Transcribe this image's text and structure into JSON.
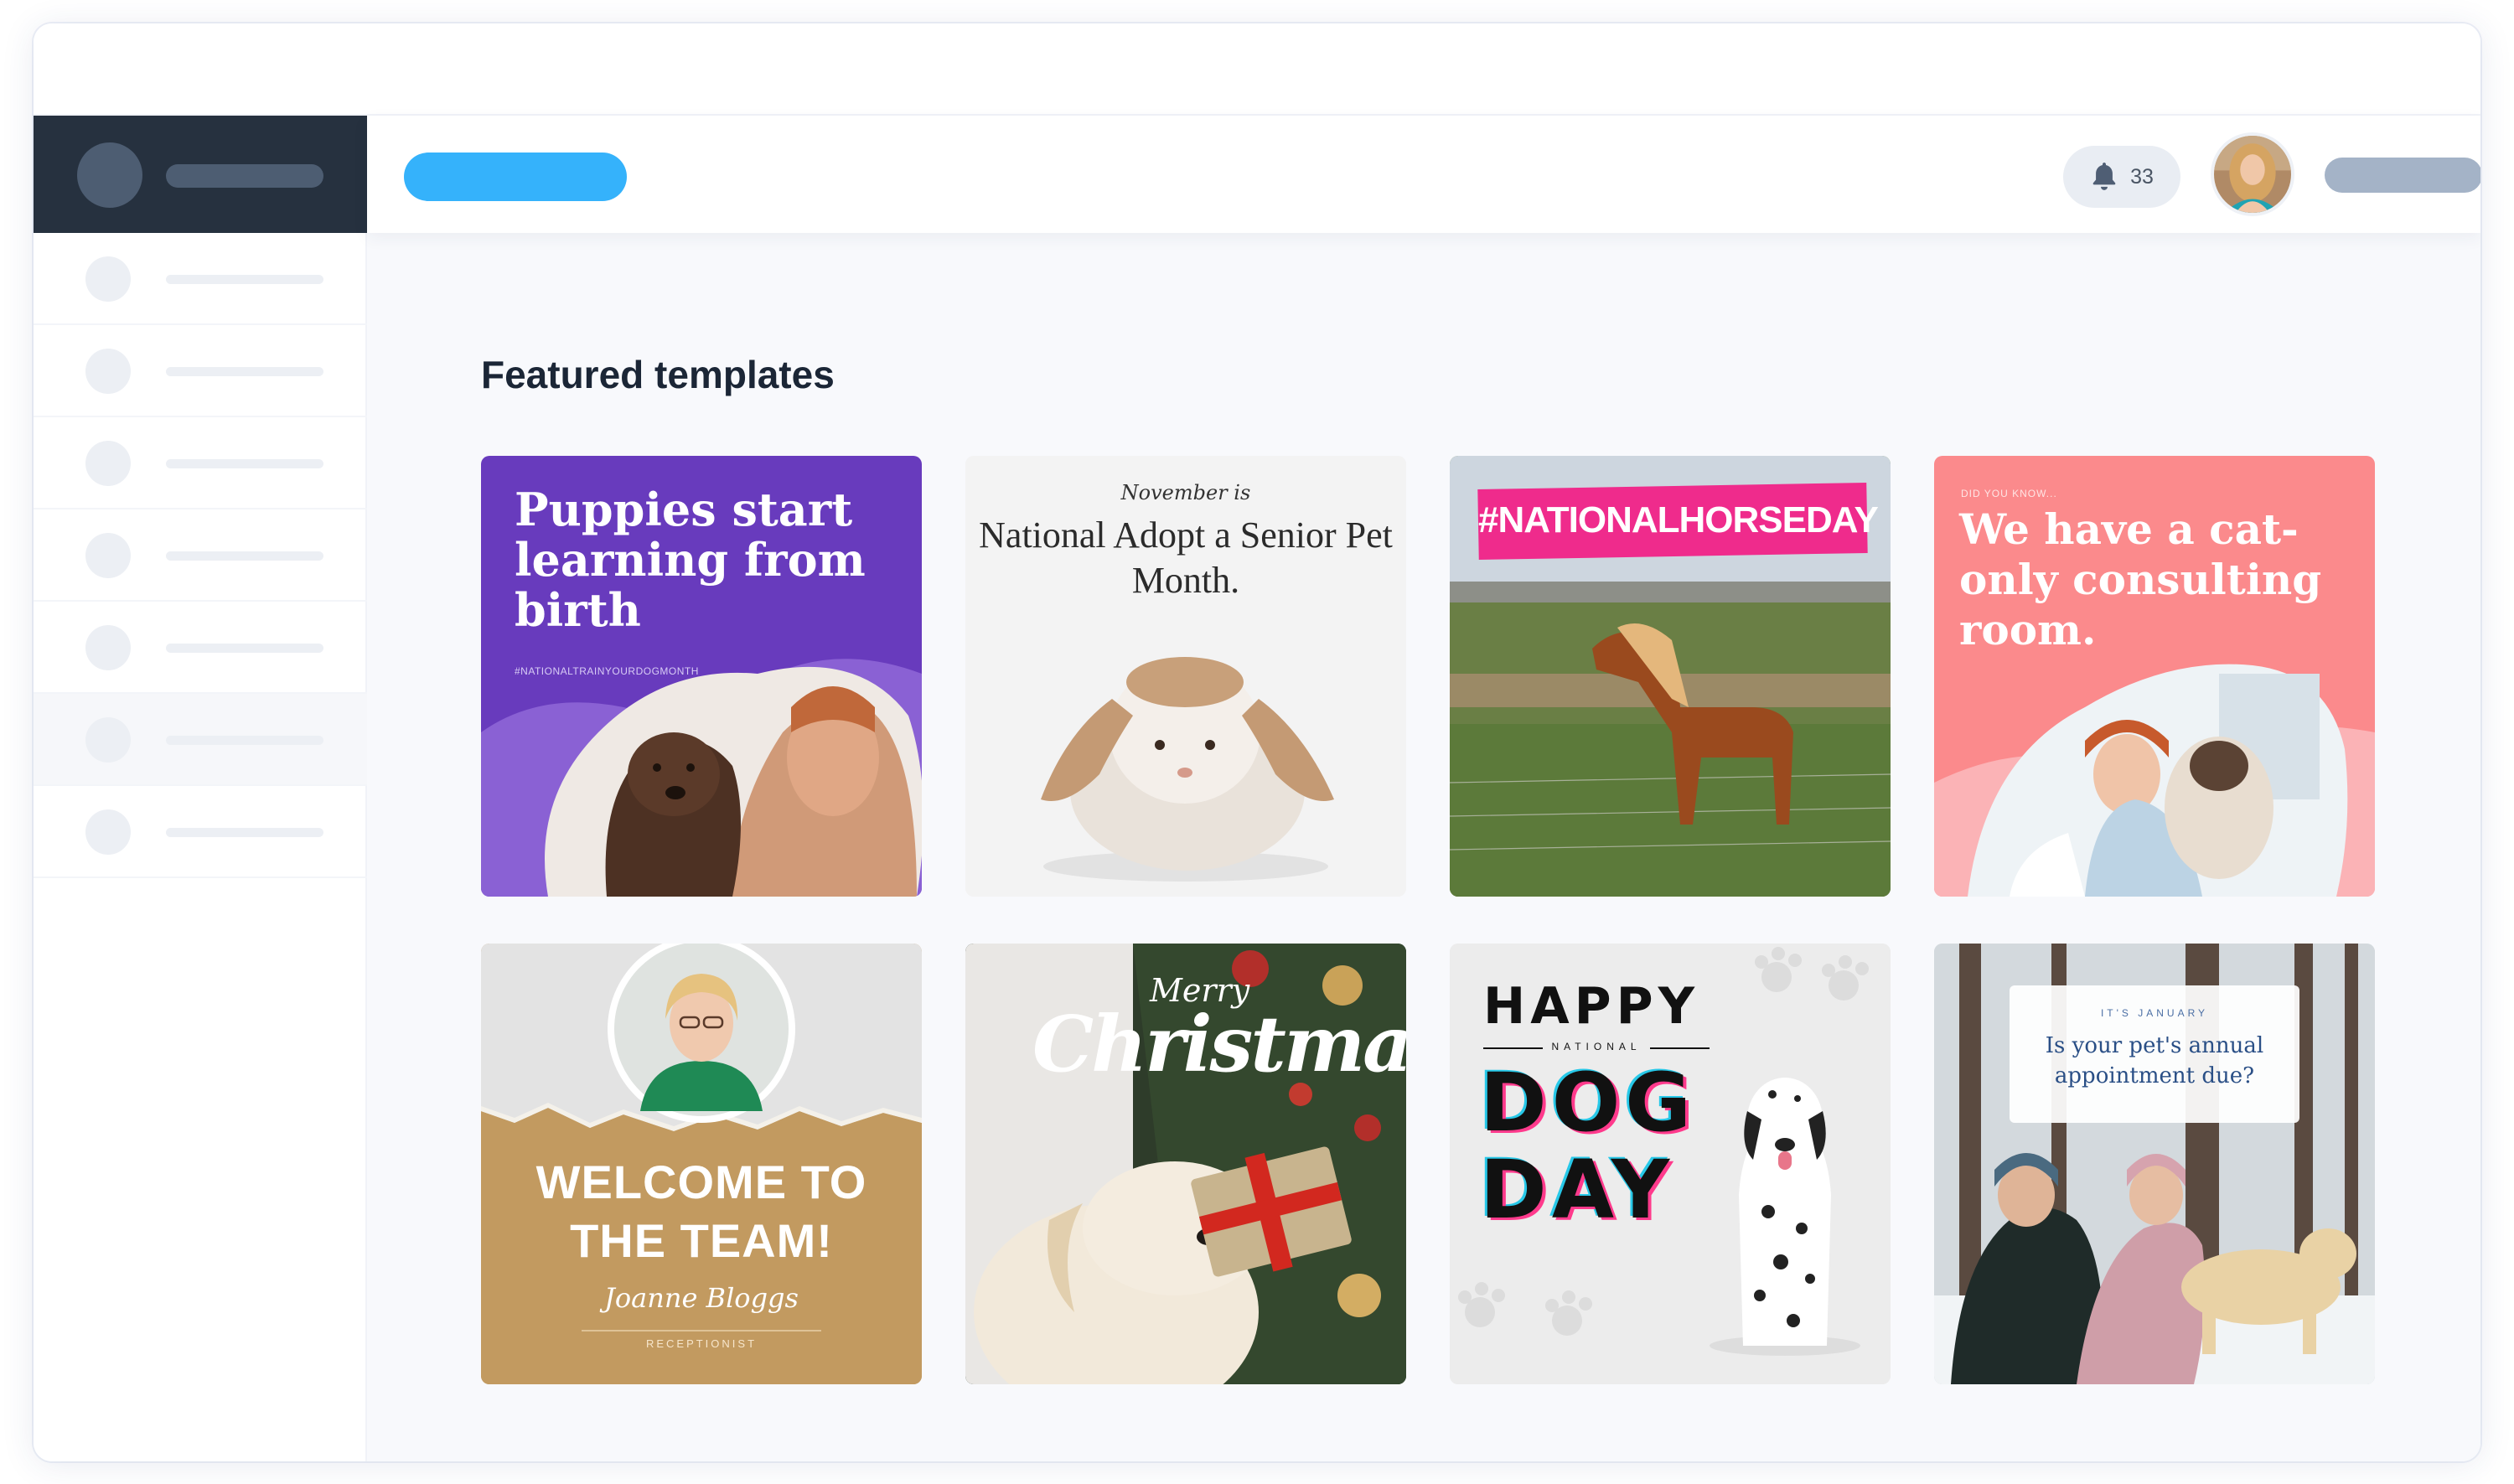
{
  "header": {
    "notification_count": "33"
  },
  "main": {
    "section_title": "Featured templates"
  },
  "templates": [
    {
      "headline": "Puppies start learning from birth",
      "hashtag": "#NATIONALTRAINYOURDOGMONTH"
    },
    {
      "kicker": "November is",
      "headline": "National Adopt a Senior Pet Month."
    },
    {
      "headline": "#NATIONALHORSEDAY"
    },
    {
      "kicker": "DID YOU KNOW...",
      "headline": "We have a cat-only consulting room."
    },
    {
      "headline": "WELCOME TO THE TEAM!",
      "name": "Joanne Bloggs",
      "role": "RECEPTIONIST"
    },
    {
      "kicker": "Merry",
      "headline": "Christmas"
    },
    {
      "line1": "HAPPY",
      "line2": "NATIONAL",
      "line3": "DOG DAY"
    },
    {
      "kicker": "IT'S JANUARY",
      "headline": "Is your pet's annual appointment due?"
    }
  ],
  "colors": {
    "accent_pill": "#35b2fb",
    "sidebar_dark": "#26313f",
    "purple": "#683bbd",
    "pink_tag": "#ef2b8c",
    "coral": "#fb8a8c"
  }
}
